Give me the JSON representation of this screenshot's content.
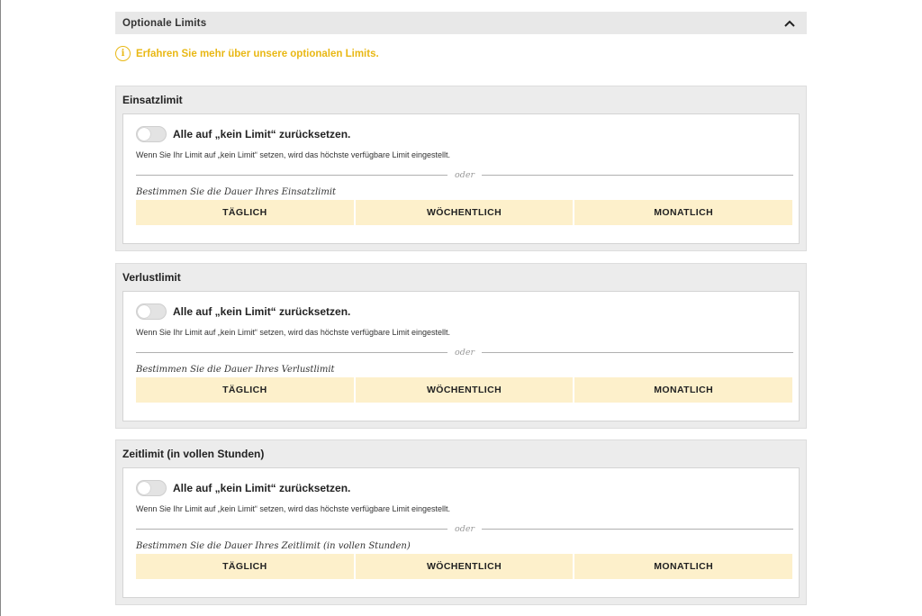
{
  "accordion": {
    "title": "Optionale Limits",
    "toggle_icon": "chevron-up-icon"
  },
  "info": {
    "icon": "info-icon",
    "icon_glyph": "i",
    "link_text": "Erfahren Sie mehr über unsere optionalen Limits.",
    "color": "#e9b815"
  },
  "sections": [
    {
      "title": "Einsatzlimit",
      "reset_label": "Alle auf „kein Limit“ zurücksetzen.",
      "reset_enabled": false,
      "hint": "Wenn Sie Ihr Limit auf „kein Limit“ setzen, wird das höchste verfügbare Limit eingestellt.",
      "divider_text": "oder",
      "duration_label": "Bestimmen Sie die Dauer Ihres Einsatzlimit",
      "periods": [
        "TÄGLICH",
        "WÖCHENTLICH",
        "MONATLICH"
      ]
    },
    {
      "title": "Verlustlimit",
      "reset_label": "Alle auf „kein Limit“ zurücksetzen.",
      "reset_enabled": false,
      "hint": "Wenn Sie Ihr Limit auf „kein Limit“ setzen, wird das höchste verfügbare Limit eingestellt.",
      "divider_text": "oder",
      "duration_label": "Bestimmen Sie die Dauer Ihres Verlustlimit",
      "periods": [
        "TÄGLICH",
        "WÖCHENTLICH",
        "MONATLICH"
      ]
    },
    {
      "title": "Zeitlimit (in vollen Stunden)",
      "reset_label": "Alle auf „kein Limit“ zurücksetzen.",
      "reset_enabled": false,
      "hint": "Wenn Sie Ihr Limit auf „kein Limit“ setzen, wird das höchste verfügbare Limit eingestellt.",
      "divider_text": "oder",
      "duration_label": "Bestimmen Sie die Dauer Ihres Zeitlimit (in vollen Stunden)",
      "periods": [
        "TÄGLICH",
        "WÖCHENTLICH",
        "MONATLICH"
      ]
    }
  ],
  "colors": {
    "period_button_bg": "#fdf0cb",
    "section_bg": "#ececec",
    "header_bg": "#e8e8e8"
  }
}
